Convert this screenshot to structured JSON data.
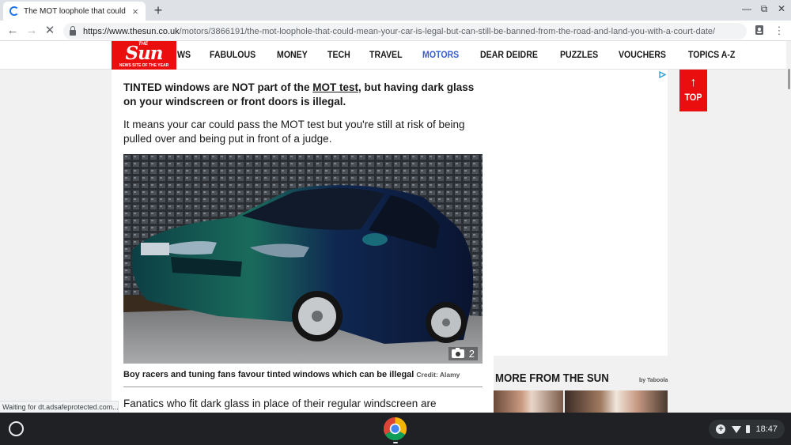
{
  "browser": {
    "tab_title": "The MOT loophole that could mean your car is legal but can still be banned",
    "tab_close": "×",
    "new_tab": "+",
    "url_host": "https://www.thesun.co.uk",
    "url_path": "/motors/3866191/the-mot-loophole-that-could-mean-your-car-is-legal-but-can-still-be-banned-from-the-road-and-land-you-with-a-court-date/",
    "status": "Waiting for dt.adsafeprotected.com..."
  },
  "site": {
    "logo_the": "THE",
    "logo_name": "Sun",
    "logo_tagline": "NEWS SITE OF THE YEAR",
    "nav": [
      "WS",
      "FABULOUS",
      "MONEY",
      "TECH",
      "TRAVEL",
      "MOTORS",
      "DEAR DEIDRE",
      "PUZZLES",
      "VOUCHERS",
      "TOPICS A-Z"
    ],
    "active_nav": "MOTORS",
    "top_button": "TOP"
  },
  "article": {
    "lede_start": "TINTED windows are NOT part of the ",
    "lede_link": "MOT test,",
    "lede_end": " but having dark glass on your windscreen or front doors is illegal.",
    "paragraph": "It means your car could pass the MOT test but you're still at risk of being pulled over and being put in front of a judge.",
    "gallery_count": "2",
    "caption": "Boy racers and tuning fans favour tinted windows which can be illegal",
    "credit": "Credit: Alamy",
    "paragraph2_left": "Fanatics who fit dark glass",
    "paragraph2_right": "in place of their regular windscreen are"
  },
  "sidebar": {
    "more_title": "MORE FROM THE SUN",
    "taboola": "by Taboola"
  },
  "shelf": {
    "time": "18:47"
  },
  "colors": {
    "brand_red": "#eb0e0e",
    "active_nav": "#3a5fcd",
    "shelf": "#1f2124"
  }
}
